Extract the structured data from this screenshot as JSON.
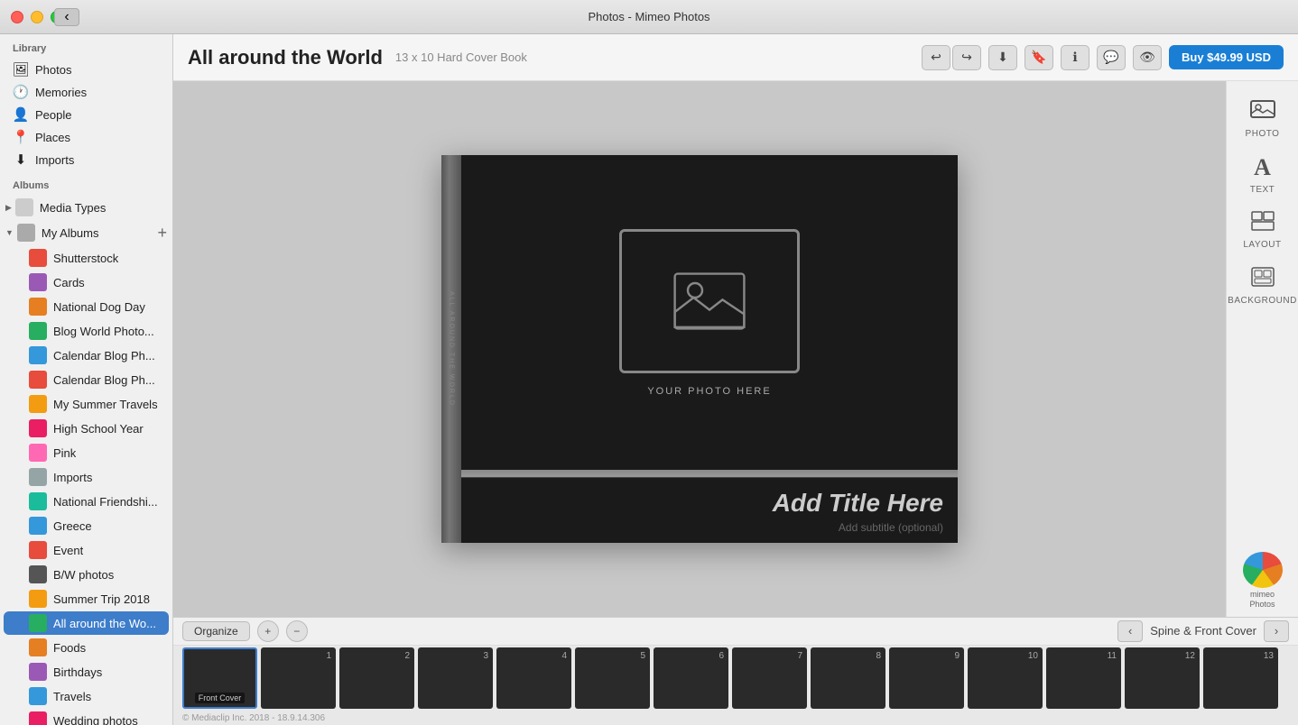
{
  "titleBar": {
    "title": "Photos - Mimeo Photos",
    "backButton": "‹"
  },
  "sidebar": {
    "libraryLabel": "Library",
    "libraryItems": [
      {
        "id": "photos",
        "label": "Photos",
        "icon": "🖼"
      },
      {
        "id": "memories",
        "label": "Memories",
        "icon": "🕐"
      },
      {
        "id": "people",
        "label": "People",
        "icon": "👤"
      },
      {
        "id": "places",
        "label": "Places",
        "icon": "📍"
      },
      {
        "id": "imports",
        "label": "Imports",
        "icon": "⬇"
      }
    ],
    "albumsLabel": "Albums",
    "mediaTypes": {
      "label": "Media Types",
      "expanded": false
    },
    "myAlbums": {
      "label": "My Albums",
      "expanded": true,
      "addBtn": "+",
      "items": [
        {
          "id": "shutterstock",
          "label": "Shutterstock",
          "color": "#e74c3c"
        },
        {
          "id": "cards",
          "label": "Cards",
          "color": "#9b59b6"
        },
        {
          "id": "national-dog-day",
          "label": "National Dog Day",
          "color": "#e67e22"
        },
        {
          "id": "blog-world-photo",
          "label": "Blog World Photo...",
          "color": "#27ae60"
        },
        {
          "id": "calendar-blog-ph1",
          "label": "Calendar Blog Ph...",
          "color": "#3498db"
        },
        {
          "id": "calendar-blog-ph2",
          "label": "Calendar Blog Ph...",
          "color": "#e74c3c"
        },
        {
          "id": "my-summer-travels",
          "label": "My Summer Travels",
          "color": "#f39c12"
        },
        {
          "id": "high-school-year",
          "label": "High School Year",
          "color": "#e91e63"
        },
        {
          "id": "pink",
          "label": "Pink",
          "color": "#ff69b4"
        },
        {
          "id": "imports",
          "label": "Imports",
          "color": "#95a5a6"
        },
        {
          "id": "national-friendship",
          "label": "National Friendshi...",
          "color": "#1abc9c"
        },
        {
          "id": "greece",
          "label": "Greece",
          "color": "#3498db"
        },
        {
          "id": "event",
          "label": "Event",
          "color": "#e74c3c"
        },
        {
          "id": "bw-photos",
          "label": "B/W photos",
          "color": "#555"
        },
        {
          "id": "summer-trip-2018",
          "label": "Summer Trip 2018",
          "color": "#f39c12"
        },
        {
          "id": "all-around-world",
          "label": "All around the Wo...",
          "color": "#27ae60",
          "active": true
        },
        {
          "id": "foods",
          "label": "Foods",
          "color": "#e67e22"
        },
        {
          "id": "birthdays",
          "label": "Birthdays",
          "color": "#9b59b6"
        },
        {
          "id": "travels",
          "label": "Travels",
          "color": "#3498db"
        },
        {
          "id": "wedding-photos",
          "label": "Wedding photos",
          "color": "#e91e63"
        }
      ]
    }
  },
  "header": {
    "bookTitle": "All around the World",
    "bookSpec": "13 x 10 Hard Cover Book",
    "undoLabel": "↩",
    "redoLabel": "↪",
    "buyLabel": "Buy $49.99 USD"
  },
  "canvas": {
    "spineText": "All around the World",
    "photoPlaceholderLabel": "YOUR PHOTO HERE",
    "titlePlaceholder": "Add Title Here",
    "subtitlePlaceholder": "Add subtitle (optional)"
  },
  "rightPanel": {
    "items": [
      {
        "id": "photo",
        "label": "PHOTO",
        "icon": "🖼"
      },
      {
        "id": "text",
        "label": "TEXT",
        "icon": "A"
      },
      {
        "id": "layout",
        "label": "LAYOUT",
        "icon": "⊞"
      },
      {
        "id": "background",
        "label": "BACKGROUND",
        "icon": "▦"
      }
    ],
    "mimeoLabel": "mimeo\nPhotos"
  },
  "bottomBar": {
    "organizeLabel": "Organize",
    "pageLocation": "Spine & Front Cover",
    "copyright": "© Mediaclip Inc. 2018 - 18.9.14.306"
  },
  "filmstrip": {
    "items": [
      {
        "id": "front-cover",
        "label": "Front Cover",
        "selected": true
      },
      {
        "id": "p1",
        "num": "1"
      },
      {
        "id": "p2",
        "num": "2"
      },
      {
        "id": "p3",
        "num": "3"
      },
      {
        "id": "p4",
        "num": "4"
      },
      {
        "id": "p5",
        "num": "5"
      },
      {
        "id": "p6",
        "num": "6"
      },
      {
        "id": "p7",
        "num": "7"
      },
      {
        "id": "p8",
        "num": "8"
      },
      {
        "id": "p9",
        "num": "9"
      },
      {
        "id": "p10",
        "num": "10"
      },
      {
        "id": "p11",
        "num": "11"
      },
      {
        "id": "p12",
        "num": "12"
      },
      {
        "id": "p13",
        "num": "13"
      }
    ]
  }
}
